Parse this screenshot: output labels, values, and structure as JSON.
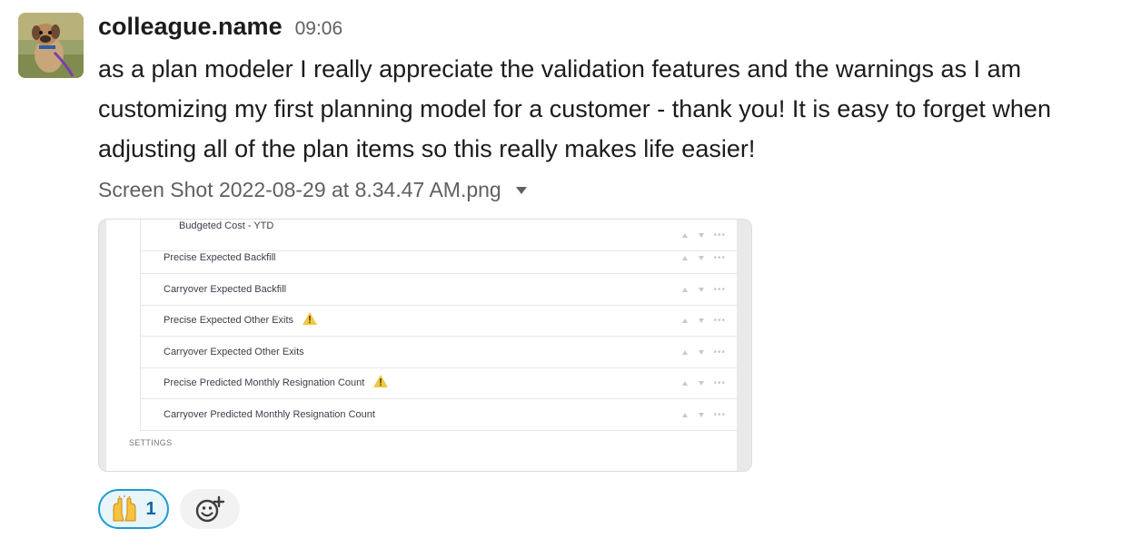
{
  "message": {
    "username": "colleague.name",
    "timestamp": "09:06",
    "text": "as a plan modeler I really appreciate the validation features and the warnings as I am customizing my first planning model for a customer - thank you!  It is easy to forget when adjusting all of the plan items so this really makes life easier!",
    "avatar_icon": "dog-photo-avatar"
  },
  "attachment": {
    "file_name": "Screen Shot 2022-08-29 at 8.34.47 AM.png",
    "caret_icon": "caret-down-icon",
    "rows": [
      {
        "label": "Budgeted Cost - YTD",
        "warning": false
      },
      {
        "label": "Precise Expected Backfill",
        "warning": false
      },
      {
        "label": "Carryover Expected Backfill",
        "warning": false
      },
      {
        "label": "Precise Expected Other Exits",
        "warning": true
      },
      {
        "label": "Carryover Expected Other Exits",
        "warning": false
      },
      {
        "label": "Precise Predicted Monthly Resignation Count",
        "warning": true
      },
      {
        "label": "Carryover Predicted Monthly Resignation Count",
        "warning": false
      }
    ],
    "settings_label": "SETTINGS",
    "warning_color": "#f2c744"
  },
  "reactions": {
    "items": [
      {
        "emoji": "raising-hands",
        "count": "1"
      }
    ],
    "add_icon": "add-reaction-icon",
    "accent_color": "#1d9bd1"
  }
}
